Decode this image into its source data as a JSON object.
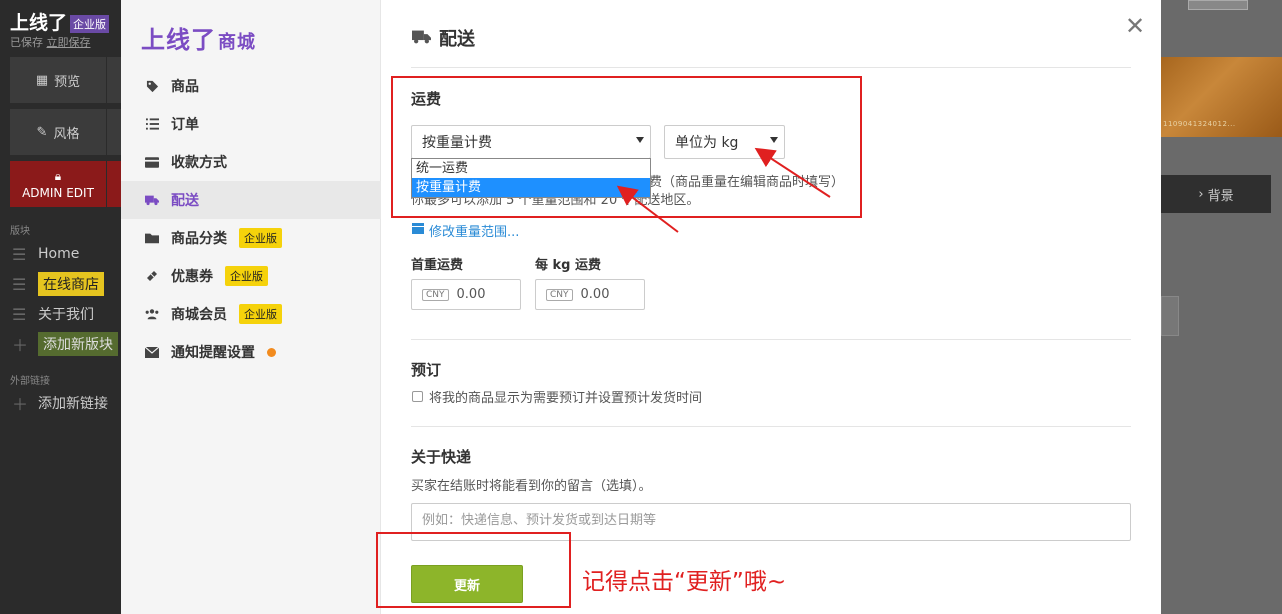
{
  "background": {
    "logo": "上线了",
    "logo_badge": "企业版",
    "saved_text": "已保存",
    "save_all": "立即保存",
    "btn_preview": "预览",
    "btn_style": "风格",
    "btn_admin": "ADMIN EDIT",
    "section_blocks": "版块",
    "nav_items": [
      "Home",
      "在线商店",
      "关于我们",
      "添加新版块"
    ],
    "section_external": "外部链接",
    "add_link": "添加新链接",
    "right_button": "背景",
    "banner_text": "1109041324012..."
  },
  "sidebar": {
    "brand": "上线了",
    "brand_sub": "商城",
    "items": [
      {
        "label": "商品",
        "icon": "tag-icon"
      },
      {
        "label": "订单",
        "icon": "list-icon"
      },
      {
        "label": "收款方式",
        "icon": "credit-card-icon"
      },
      {
        "label": "配送",
        "icon": "truck-icon",
        "active": true
      },
      {
        "label": "商品分类",
        "icon": "folder-icon",
        "badge": "企业版"
      },
      {
        "label": "优惠券",
        "icon": "ticket-icon",
        "badge": "企业版"
      },
      {
        "label": "商城会员",
        "icon": "users-icon",
        "badge": "企业版"
      },
      {
        "label": "通知提醒设置",
        "icon": "envelope-icon",
        "dot": true
      }
    ]
  },
  "content": {
    "title": "配送",
    "shipping": {
      "heading": "运费",
      "method_selected": "按重量计费",
      "method_options": [
        "统一运费",
        "按重量计费"
      ],
      "unit_selected": "单位为 kg",
      "help_line1_tail": "费（商品重量在编辑商品时填写）",
      "help_line2": "你最多可以添加 5 个重量范围和 20 个配送地区。",
      "edit_range_link": "修改重量范围...",
      "first_weight_label": "首重运费",
      "per_kg_label": "每 kg 运费",
      "currency": "CNY",
      "first_weight_value": "0.00",
      "per_kg_value": "0.00"
    },
    "preorder": {
      "heading": "预订",
      "checkbox_label": "将我的商品显示为需要预订并设置预计发货时间"
    },
    "express": {
      "heading": "关于快递",
      "desc": "买家在结账时将能看到你的留言（选填）。",
      "placeholder": "例如：快递信息、预计发货或到达日期等"
    },
    "update_button": "更新"
  },
  "annotation": "记得点击“更新”哦~"
}
